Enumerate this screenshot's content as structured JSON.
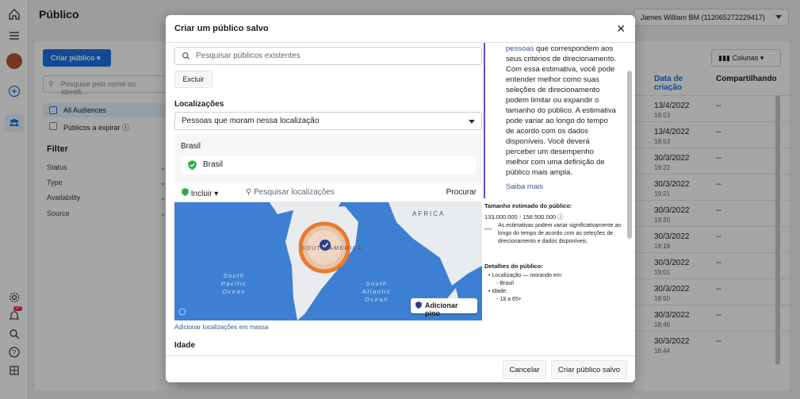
{
  "page": {
    "title": "Público",
    "account": "James William BM (112065272229417)"
  },
  "left": {
    "create_label": "Criar público",
    "search_placeholder": "Pesquise pelo nome ou identifi...",
    "audiences": [
      {
        "label": "All Audiences"
      },
      {
        "label": "Públicos a expirar"
      }
    ],
    "filter_heading": "Filter",
    "filters": [
      "Status",
      "Type",
      "Availability",
      "Source"
    ]
  },
  "rail": {
    "notification_badge": "20"
  },
  "table": {
    "columns_label": "Colunas",
    "headers": {
      "date": "Data de criação",
      "sharing": "Compartilhando"
    },
    "rows": [
      {
        "date": "13/4/2022",
        "time": "18:53",
        "sharing": "--"
      },
      {
        "date": "13/4/2022",
        "time": "18:53",
        "sharing": "--"
      },
      {
        "date": "30/3/2022",
        "time": "19:22",
        "sharing": "--"
      },
      {
        "date": "30/3/2022",
        "time": "19:21",
        "sharing": "--"
      },
      {
        "date": "30/3/2022",
        "time": "19:20",
        "sharing": "--"
      },
      {
        "date": "30/3/2022",
        "time": "19:18",
        "sharing": "--"
      },
      {
        "date": "30/3/2022",
        "time": "19:01",
        "sharing": "--"
      },
      {
        "date": "30/3/2022",
        "time": "18:50",
        "sharing": "--"
      },
      {
        "date": "30/3/2022",
        "time": "18:46",
        "sharing": "--"
      },
      {
        "date": "30/3/2022",
        "time": "18:44",
        "sharing": "--"
      }
    ]
  },
  "modal": {
    "title": "Criar um público salvo",
    "search_placeholder": "Pesquisar públicos existentes",
    "exclude_label": "Excluir",
    "locations_heading": "Localizações",
    "location_mode": "Pessoas que moram nessa localização",
    "country_heading": "Brasil",
    "country_chip": "Brasil",
    "include_label": "Incluir",
    "search_locations": "Pesquisar localizações",
    "procurar": "Procurar",
    "map_labels": {
      "africa": "AFRICA",
      "south_america": "SOUTH AMERICA",
      "spo": "South Pacific Ocean",
      "sao": "South Atlantic Ocean"
    },
    "add_pin": "Adicionar pino",
    "mass_link": "Adicionar localizações em massa",
    "age_heading": "Idade",
    "desc_link": "pessoas",
    "desc_text": " que correspondem aos seus critérios de direcionamento. Com essa estimativa, você pode entender melhor como suas seleções de direcionamento podem limitar ou expandir o tamanho do público. A estimativa pode variar ao longo do tempo de acordo com os dados disponíveis. Você deverá perceber um desempenho melhor com uma definição de público mais ampla.",
    "saiba_mais": "Saiba mais",
    "estimate_heading": "Tamanho estimado do público:",
    "estimate_value": "133.000.000 - 156.500.000",
    "estimate_note": "As estimativas podem variar significativamente ao longo do tempo de acordo com as seleções de direcionamento e dados disponíveis.",
    "details_heading": "Detalhes do público:",
    "details": [
      "Localização — morando em:",
      "Brasil",
      "Idade:",
      "18 a 65+"
    ],
    "cancel_label": "Cancelar",
    "save_label": "Criar público salvo"
  }
}
